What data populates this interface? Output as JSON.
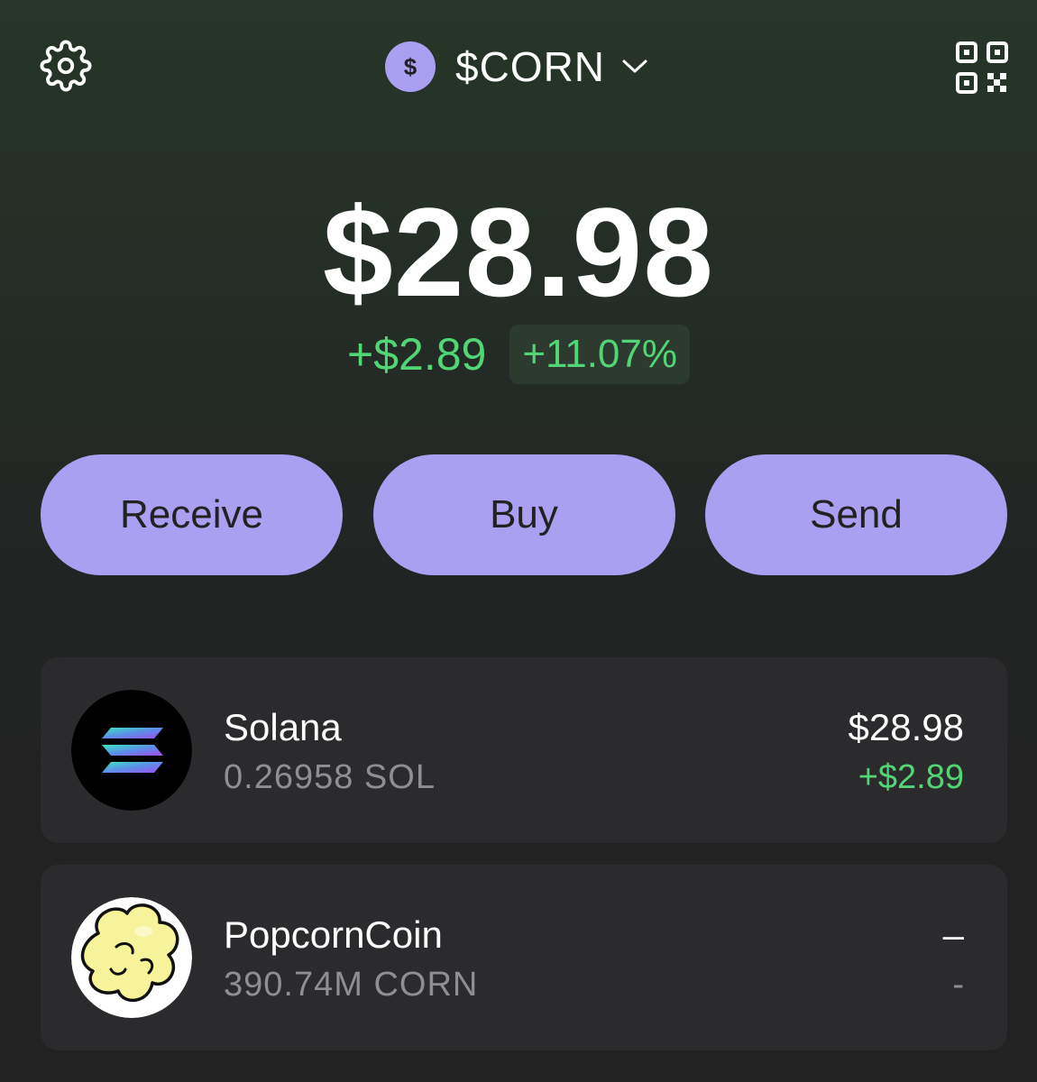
{
  "header": {
    "account_initial": "$",
    "account_name": "$CORN",
    "settings_icon": "gear-icon",
    "dropdown_icon": "chevron-down-icon",
    "qr_icon": "qr-code-icon"
  },
  "portfolio": {
    "balance": "$28.98",
    "change_amount": "+$2.89",
    "change_percent": "+11.07%"
  },
  "actions": {
    "receive_label": "Receive",
    "buy_label": "Buy",
    "send_label": "Send"
  },
  "tokens": [
    {
      "name": "Solana",
      "amount": "0.26958 SOL",
      "value": "$28.98",
      "change": "+$2.89",
      "icon": "solana-logo-icon"
    },
    {
      "name": "PopcornCoin",
      "amount": "390.74M CORN",
      "value": "–",
      "change": "-",
      "icon": "popcorn-logo-icon"
    }
  ],
  "colors": {
    "accent": "#aa9ff0",
    "positive": "#52d575",
    "card": "#2b2b2e",
    "muted_text": "#8e8e93"
  }
}
